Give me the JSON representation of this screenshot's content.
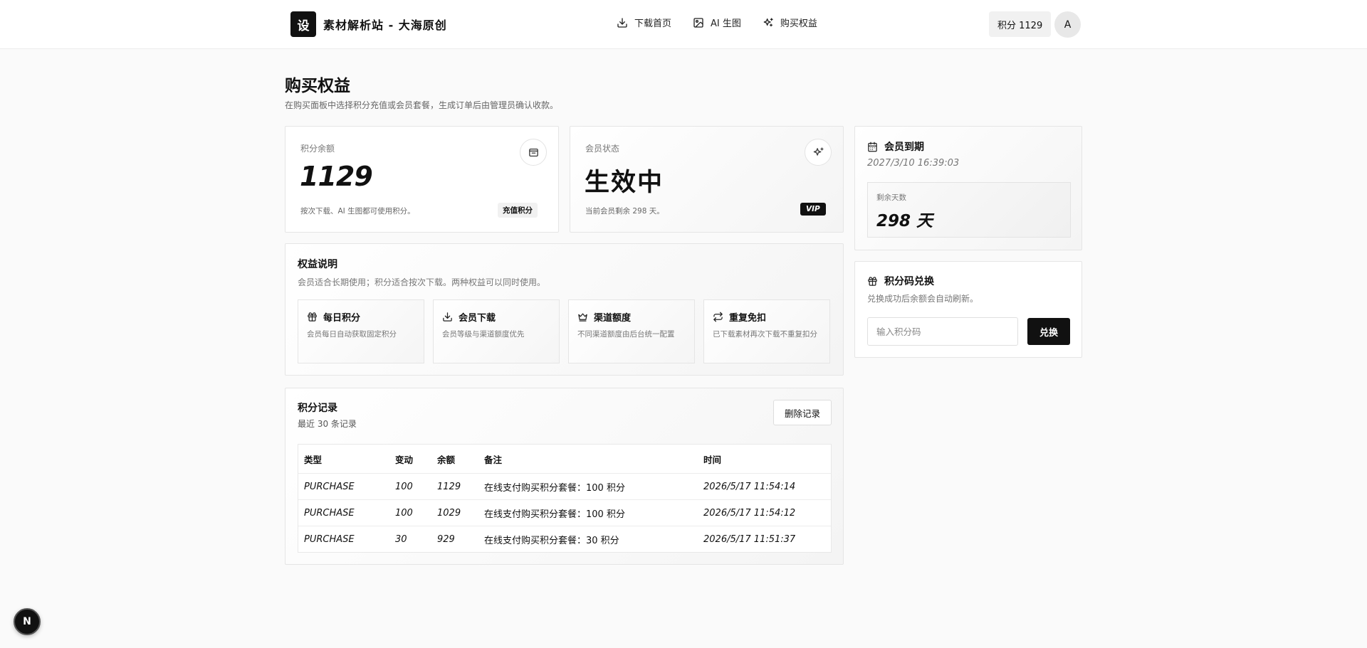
{
  "header": {
    "logo_char": "设",
    "brand": "素材解析站 - 大海原创",
    "nav": [
      {
        "label": "下载首页",
        "icon": "download-icon"
      },
      {
        "label": "AI 生图",
        "icon": "image-icon"
      },
      {
        "label": "购买权益",
        "icon": "sparkles-icon"
      }
    ],
    "points_badge": "积分 1129",
    "avatar": "A"
  },
  "page": {
    "title": "购买权益",
    "subtitle": "在购买面板中选择积分充值或会员套餐，生成订单后由管理员确认收款。"
  },
  "points_card": {
    "label": "积分余额",
    "value": "1129",
    "hint": "按次下载、AI 生图都可使用积分。",
    "tag": "充值积分",
    "icon": "wallet-icon"
  },
  "member_card": {
    "label": "会员状态",
    "value": "生效中",
    "hint": "当前会员剩余 298 天。",
    "tag": "VIP",
    "icon": "sparkles-icon"
  },
  "benefits": {
    "title": "权益说明",
    "subtitle": "会员适合长期使用；积分适合按次下载。两种权益可以同时使用。",
    "items": [
      {
        "title": "每日积分",
        "desc": "会员每日自动获取固定积分",
        "icon": "gift-icon"
      },
      {
        "title": "会员下载",
        "desc": "会员等级与渠道额度优先",
        "icon": "download-icon"
      },
      {
        "title": "渠道额度",
        "desc": "不同渠道额度由后台统一配置",
        "icon": "crown-icon"
      },
      {
        "title": "重复免扣",
        "desc": "已下载素材再次下载不重复扣分",
        "icon": "repeat-icon"
      }
    ]
  },
  "records": {
    "title": "积分记录",
    "subtitle": "最近 30 条记录",
    "delete_label": "删除记录",
    "columns": [
      "类型",
      "变动",
      "余额",
      "备注",
      "时间"
    ],
    "rows": [
      {
        "type": "PURCHASE",
        "change": "100",
        "balance": "1129",
        "note": "在线支付购买积分套餐：100 积分",
        "time": "2026/5/17 11:54:14"
      },
      {
        "type": "PURCHASE",
        "change": "100",
        "balance": "1029",
        "note": "在线支付购买积分套餐：100 积分",
        "time": "2026/5/17 11:54:12"
      },
      {
        "type": "PURCHASE",
        "change": "30",
        "balance": "929",
        "note": "在线支付购买积分套餐：30 积分",
        "time": "2026/5/17 11:51:37"
      }
    ]
  },
  "expiry": {
    "title": "会员到期",
    "date": "2027/3/10 16:39:03",
    "remaining_label": "剩余天数",
    "remaining_value": "298 天",
    "icon": "calendar-icon"
  },
  "redeem": {
    "title": "积分码兑换",
    "subtitle": "兑换成功后余额会自动刷新。",
    "placeholder": "输入积分码",
    "button": "兑换",
    "icon": "gift-icon"
  },
  "floating": {
    "label": "N"
  },
  "colors": {
    "accent": "#111111",
    "background": "#fafafa",
    "border": "#e5e5e5"
  }
}
